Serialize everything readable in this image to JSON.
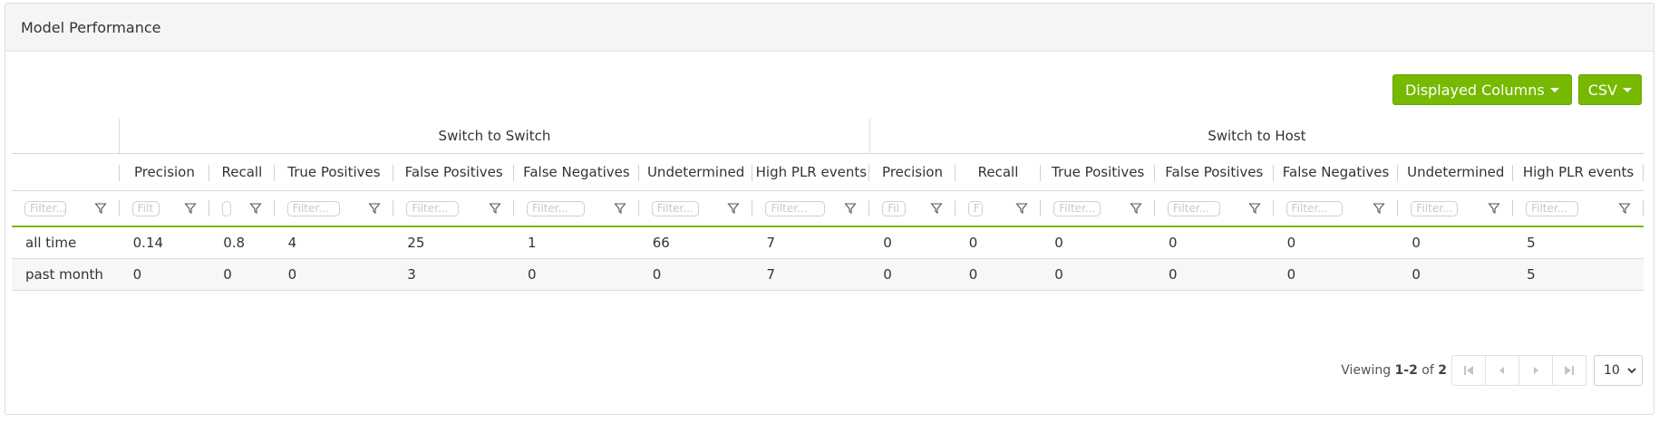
{
  "panel": {
    "title": "Model Performance"
  },
  "toolbar": {
    "displayed_columns_label": "Displayed Columns",
    "csv_label": "CSV"
  },
  "groups": [
    "Switch to Switch",
    "Switch to Host"
  ],
  "columns": [
    "Precision",
    "Recall",
    "True Positives",
    "False Positives",
    "False Negatives",
    "Undetermined",
    "High PLR events",
    "Precision",
    "Recall",
    "True Positives",
    "False Positives",
    "False Negatives",
    "Undetermined",
    "High PLR events"
  ],
  "filters": [
    "Filter...",
    "Filt",
    "",
    "Filter...",
    "Filter...",
    "Filter...",
    "Filter...",
    "Filter...",
    "Fil",
    "F",
    "Filter...",
    "Filter...",
    "Filter...",
    "Filter...",
    "Filter..."
  ],
  "rows": [
    {
      "label": "all time",
      "values": [
        "0.14",
        "0.8",
        "4",
        "25",
        "1",
        "66",
        "7",
        "0",
        "0",
        "0",
        "0",
        "0",
        "0",
        "5"
      ]
    },
    {
      "label": "past month",
      "values": [
        "0",
        "0",
        "0",
        "3",
        "0",
        "0",
        "7",
        "0",
        "0",
        "0",
        "0",
        "0",
        "0",
        "5"
      ]
    }
  ],
  "pager": {
    "viewing": "Viewing",
    "range": "1-2",
    "of": "of",
    "total": "2",
    "page_size": "10"
  },
  "colors": {
    "accent": "#76b900"
  }
}
